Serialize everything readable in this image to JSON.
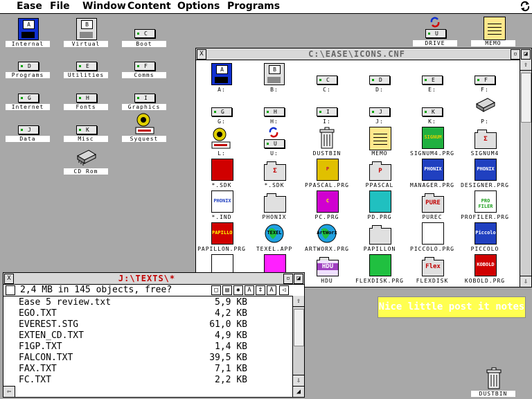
{
  "menubar": {
    "items": [
      "Ease",
      "File",
      "Window",
      "Content",
      "Options",
      "Programs"
    ]
  },
  "desktop": {
    "icons": [
      {
        "label": "Internal",
        "letter": "A"
      },
      {
        "label": "Virtual",
        "letter": "B"
      },
      {
        "label": "Boot",
        "letter": "C"
      },
      {
        "label": "Programs",
        "letter": "D"
      },
      {
        "label": "Utilities",
        "letter": "E"
      },
      {
        "label": "Comms",
        "letter": "F"
      },
      {
        "label": "Internet",
        "letter": "G"
      },
      {
        "label": "Fonts",
        "letter": "H"
      },
      {
        "label": "Graphics",
        "letter": "I"
      },
      {
        "label": "Data",
        "letter": "J"
      },
      {
        "label": "Misc",
        "letter": "K"
      },
      {
        "label": "Syquest",
        "letter": "L"
      },
      {
        "label": "CD Rom",
        "letter": ""
      },
      {
        "label": "DRIVE",
        "letter": "U"
      },
      {
        "label": "MEMO",
        "letter": ""
      },
      {
        "label": "DUSTBIN",
        "letter": ""
      }
    ]
  },
  "icons_window": {
    "title": "C:\\EASE\\ICONS.CNF",
    "items": [
      {
        "label": "A:",
        "letter": "A"
      },
      {
        "label": "B:",
        "letter": "B"
      },
      {
        "label": "C:",
        "letter": "C"
      },
      {
        "label": "D:",
        "letter": "D"
      },
      {
        "label": "E:",
        "letter": "E"
      },
      {
        "label": "F:",
        "letter": "F"
      },
      {
        "label": "G:",
        "letter": "G"
      },
      {
        "label": "H:",
        "letter": "H"
      },
      {
        "label": "I:",
        "letter": "I"
      },
      {
        "label": "J:",
        "letter": "J"
      },
      {
        "label": "K:",
        "letter": "K"
      },
      {
        "label": "P:",
        "letter": ""
      },
      {
        "label": "L:",
        "letter": ""
      },
      {
        "label": "U:",
        "letter": "U"
      },
      {
        "label": "DUSTBIN",
        "letter": ""
      },
      {
        "label": "MEMO",
        "letter": ""
      },
      {
        "label": "SIGNUM4.PRG",
        "letter": "SIGNUM"
      },
      {
        "label": "SIGNUM4",
        "letter": "Σ"
      },
      {
        "label": "*.SDK",
        "letter": ""
      },
      {
        "label": "*.SDK",
        "letter": "Σ"
      },
      {
        "label": "PPASCAL.PRG",
        "letter": "P"
      },
      {
        "label": "PPASCAL",
        "letter": "P"
      },
      {
        "label": "MANAGER.PRG",
        "letter": "PHONIX"
      },
      {
        "label": "DESIGNER.PRG",
        "letter": "PHONIX"
      },
      {
        "label": "*.IND",
        "letter": "PHONIX"
      },
      {
        "label": "PHONIX",
        "letter": ""
      },
      {
        "label": "PC.PRG",
        "letter": "C"
      },
      {
        "label": "PD.PRG",
        "letter": ""
      },
      {
        "label": "PUREC",
        "letter": "PURE"
      },
      {
        "label": "PROFILER.PRG",
        "letter": "PRO FILER"
      },
      {
        "label": "PAPILLON.PRG",
        "letter": "PAPILLON"
      },
      {
        "label": "TEXEL.APP",
        "letter": "TEXEL"
      },
      {
        "label": "ARTWORX.PRG",
        "letter": "ArtWorx"
      },
      {
        "label": "PAPILLON",
        "letter": ""
      },
      {
        "label": "PICCOLO.PRG",
        "letter": ""
      },
      {
        "label": "PICCOLO",
        "letter": "Piccolo"
      },
      {
        "label": "",
        "letter": ""
      },
      {
        "label": "",
        "letter": ""
      },
      {
        "label": "HDU",
        "letter": "HDU"
      },
      {
        "label": "FLEXDISK.PRG",
        "letter": ""
      },
      {
        "label": "FLEXDISK",
        "letter": "Flex"
      },
      {
        "label": "KOBOLD.PRG",
        "letter": "KOBOLD"
      }
    ]
  },
  "texts_window": {
    "title": "J:\\TEXTS\\*",
    "info": "2,4 MB in 145 objects, free?",
    "files": [
      {
        "name": "Ease 5 review.txt",
        "size": "5,9 KB"
      },
      {
        "name": "EGO.TXT",
        "size": "4,2 KB"
      },
      {
        "name": "EVEREST.STG",
        "size": "61,0 KB"
      },
      {
        "name": "EXTEN_CD.TXT",
        "size": "4,9 KB"
      },
      {
        "name": "F1GP.TXT",
        "size": "1,4 KB"
      },
      {
        "name": "FALCON.TXT",
        "size": "39,5 KB"
      },
      {
        "name": "FAX.TXT",
        "size": "7,1 KB"
      },
      {
        "name": "FC.TXT",
        "size": "2,2 KB"
      }
    ]
  },
  "postit": {
    "text": "Nice little post it notes"
  },
  "colors": {
    "desktop": "#a8a8a8",
    "postit_bg": "#ffff50",
    "texts_title": "#c00000"
  }
}
